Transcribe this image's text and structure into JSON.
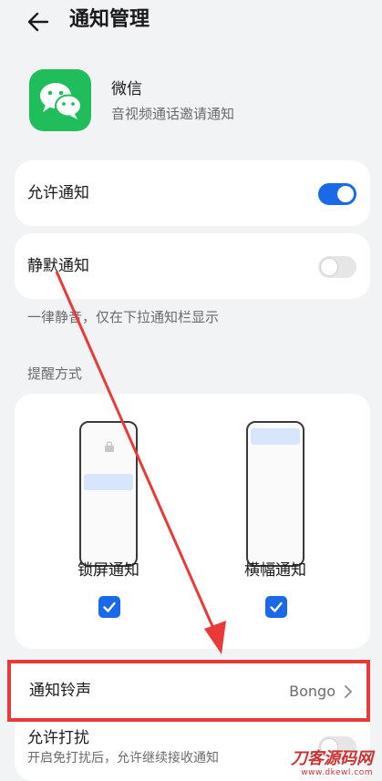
{
  "header": {
    "title": "通知管理",
    "back_icon": "arrow-left-icon"
  },
  "app": {
    "name": "微信",
    "description": "音视频通话邀请通知",
    "icon": "wechat-logo-icon",
    "icon_color": "#1fbe5a"
  },
  "allow_notifications": {
    "label": "允许通知",
    "enabled": true
  },
  "silent_notifications": {
    "label": "静默通知",
    "enabled": false,
    "hint": "一律静音，仅在下拉通知栏显示"
  },
  "reminder": {
    "section_title": "提醒方式",
    "lock_screen": {
      "label": "锁屏通知",
      "checked": true
    },
    "banner": {
      "label": "横幅通知",
      "checked": true
    }
  },
  "ringtone": {
    "label": "通知铃声",
    "value": "Bongo"
  },
  "dnd": {
    "label": "允许打扰",
    "hint": "开启免打扰后，允许继续接收通知",
    "enabled": false
  },
  "watermark": {
    "text": "刀客源码网",
    "url": "www.dkewl.com"
  },
  "colors": {
    "accent": "#1a6ae8",
    "annotation_red": "#e93a3a",
    "background": "#f1f3f5"
  }
}
